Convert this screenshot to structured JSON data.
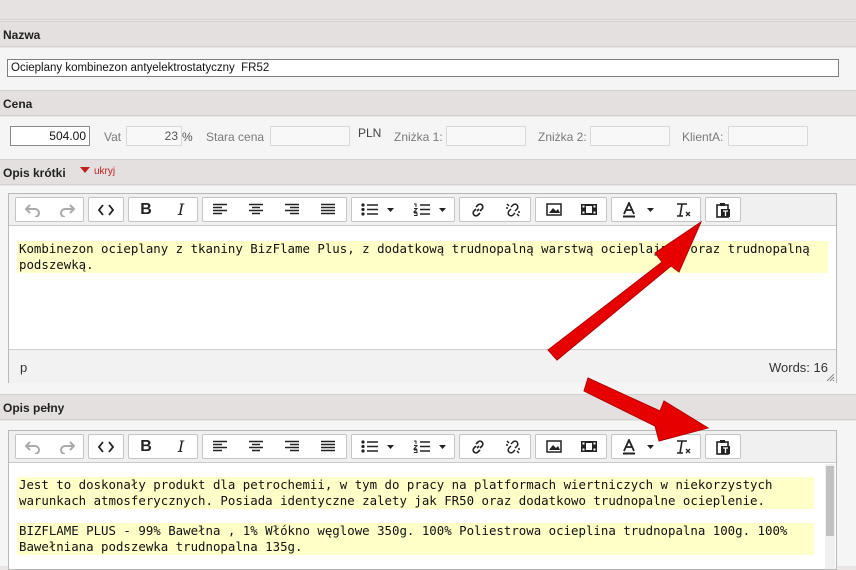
{
  "nazwa": {
    "label": "Nazwa",
    "value": "Ocieplany kombinezon antyelektrostatyczny  FR52"
  },
  "cena": {
    "label": "Cena",
    "price": "504.00",
    "vat_label": "Vat",
    "vat_value": "23",
    "vat_unit": "%",
    "old_price_label": "Stara cena",
    "currency": "PLN",
    "discount1_label": "Zniżka 1:",
    "discount2_label": "Zniżka 2:",
    "client_label": "KlientA:"
  },
  "opis_krotki": {
    "label": "Opis krótki",
    "toggle_label": "ukryj",
    "content": [
      "Kombinezon ocieplany z tkaniny BizFlame Plus, z dodatkową trudnopalną warstwą ocieplającą oraz trudnopalną podszewką."
    ],
    "status_path": "p",
    "word_count": "Words: 16"
  },
  "opis_pelny": {
    "label": "Opis pełny",
    "content": [
      "Jest to doskonały produkt dla petrochemii, w tym do pracy na platformach wiertniczych w niekorzystych warunkach atmosferycznych. Posiada identyczne zalety jak FR50 oraz dodatkowo trudnopalne ocieplenie.",
      "BIZFLAME PLUS - 99% Bawełna , 1% Włókno węglowe 350g. 100% Poliestrowa ocieplina trudnopalna 100g. 100% Bawełniana podszewka trudnopalna 135g."
    ]
  },
  "icons": [
    "undo-icon",
    "redo-icon",
    "source-code-icon",
    "bold-icon",
    "italic-icon",
    "align-left-icon",
    "align-center-icon",
    "align-right-icon",
    "align-justify-icon",
    "bullet-list-icon",
    "numbered-list-icon",
    "link-icon",
    "unlink-icon",
    "image-icon",
    "media-icon",
    "text-color-icon",
    "clear-format-icon",
    "paste-text-icon"
  ],
  "colors": {
    "highlight": "#ffffc8",
    "arrow": "#e60000",
    "toggle": "#c02020"
  }
}
